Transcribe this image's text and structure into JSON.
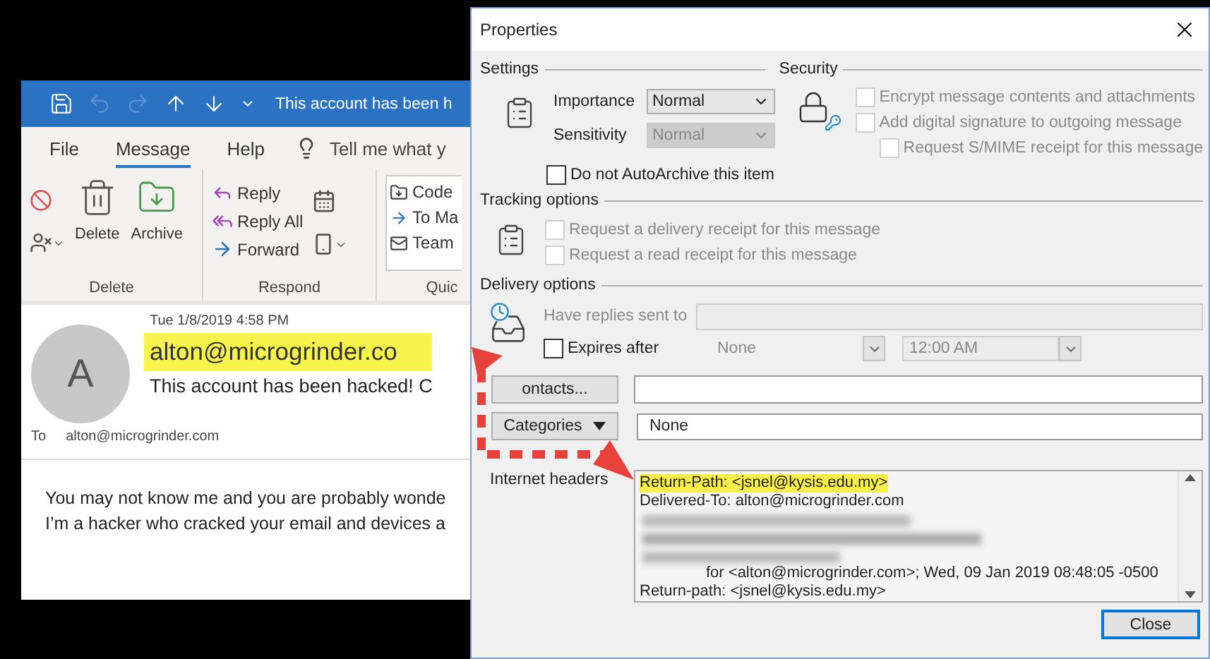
{
  "outlook": {
    "title": "This account has been h",
    "menu": [
      {
        "label": "File",
        "selected": false
      },
      {
        "label": "Message",
        "selected": true
      },
      {
        "label": "Help",
        "selected": false
      }
    ],
    "tell_me": "Tell me what y",
    "ribbon": [
      {
        "label": "Delete",
        "commands": [
          {
            "label": "Delete"
          },
          {
            "label": "Archive"
          }
        ]
      },
      {
        "label": "Respond",
        "commands": [
          {
            "label": "Reply"
          },
          {
            "label": "Reply All"
          },
          {
            "label": "Forward"
          }
        ]
      },
      {
        "label": "Quic",
        "commands": [
          {
            "label": "Code"
          },
          {
            "label": "To Ma"
          },
          {
            "label": "Team"
          }
        ]
      }
    ],
    "message": {
      "avatar": "A",
      "date": "Tue 1/8/2019 4:58 PM",
      "sender": "alton@microgrinder.co",
      "subject": "This account has been hacked! C",
      "to_label": "To",
      "to": "alton@microgrinder.com",
      "body": [
        "You may not know me and you are probably wonde",
        "I’m a hacker who cracked your email and devices a"
      ]
    }
  },
  "dialog": {
    "title": "Properties",
    "settings": {
      "label": "Settings",
      "fields": [
        {
          "label": "Importance",
          "value": "Normal",
          "disabled": false
        },
        {
          "label": "Sensitivity",
          "value": "Normal",
          "disabled": true
        }
      ]
    },
    "security": {
      "label": "Security",
      "options": [
        {
          "label": "Encrypt message contents and attachments",
          "checked": false,
          "disabled": true,
          "indented": false
        },
        {
          "label": "Add digital signature to outgoing message",
          "checked": false,
          "disabled": true,
          "indented": false
        },
        {
          "label": "Request S/MIME receipt for this message",
          "checked": false,
          "disabled": true,
          "indented": true
        }
      ]
    },
    "autoarchive": {
      "label": "Do not AutoArchive this item",
      "checked": false,
      "disabled": false
    },
    "tracking": {
      "label": "Tracking options",
      "options": [
        {
          "label": "Request a delivery receipt for this message",
          "checked": false,
          "disabled": true
        },
        {
          "label": "Request a read receipt for this message",
          "checked": false,
          "disabled": true
        }
      ]
    },
    "delivery": {
      "label": "Delivery options",
      "replies_label": "Have replies sent to",
      "expires": {
        "label": "Expires after",
        "checked": false,
        "disabled": false,
        "date": "None",
        "time": "12:00 AM"
      }
    },
    "contacts_button": "ontacts...",
    "categories": {
      "button": "Categories",
      "value": "None"
    },
    "headers": {
      "label": "Internet headers",
      "lines": [
        {
          "kind": "text",
          "text": "Return-Path: <jsnel@kysis.edu.my>",
          "highlighted": true,
          "indented": false
        },
        {
          "kind": "text",
          "text": "Delivered-To: alton@microgrinder.com",
          "highlighted": false,
          "indented": false
        },
        {
          "kind": "redacted"
        },
        {
          "kind": "text",
          "text": "for <alton@microgrinder.com>; Wed, 09 Jan 2019 08:48:05 -0500",
          "highlighted": false,
          "indented": true
        },
        {
          "kind": "text",
          "text": "Return-path: <jsnel@kysis.edu.my>",
          "highlighted": false,
          "indented": false
        }
      ]
    },
    "close_button": "Close"
  }
}
